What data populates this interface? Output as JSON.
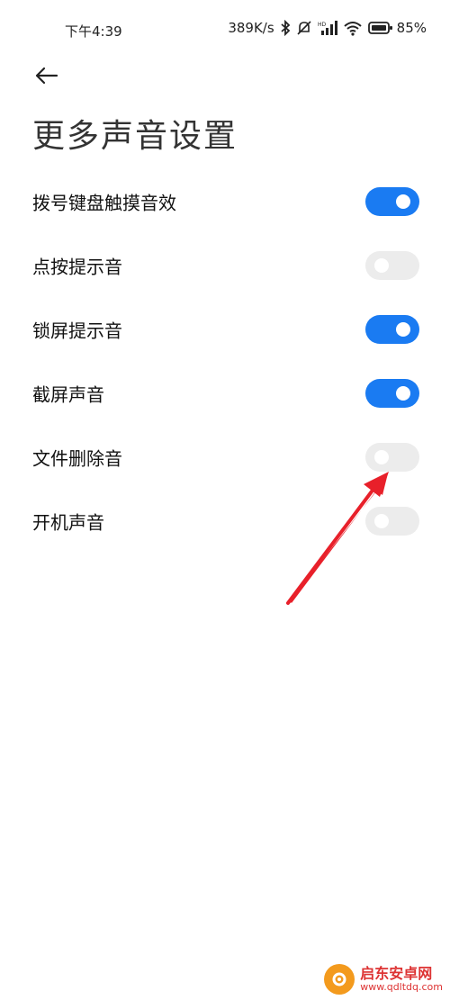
{
  "status_bar": {
    "time": "下午4:39",
    "net_speed": "389K/s",
    "battery": "85%",
    "icons": [
      "bluetooth-icon",
      "mute-icon",
      "hd-signal-icon",
      "wifi-icon",
      "battery-icon"
    ]
  },
  "header": {
    "title": "更多声音设置"
  },
  "settings": [
    {
      "label": "拨号键盘触摸音效",
      "state": "on"
    },
    {
      "label": "点按提示音",
      "state": "off"
    },
    {
      "label": "锁屏提示音",
      "state": "on"
    },
    {
      "label": "截屏声音",
      "state": "on"
    },
    {
      "label": "文件删除音",
      "state": "off"
    },
    {
      "label": "开机声音",
      "state": "off"
    }
  ],
  "colors": {
    "accent": "#1a7bf2",
    "toggle_off": "#ececec",
    "annotation_arrow": "#e8202a"
  },
  "watermark": {
    "title": "启东安卓网",
    "url": "www.qdltdq.com"
  }
}
